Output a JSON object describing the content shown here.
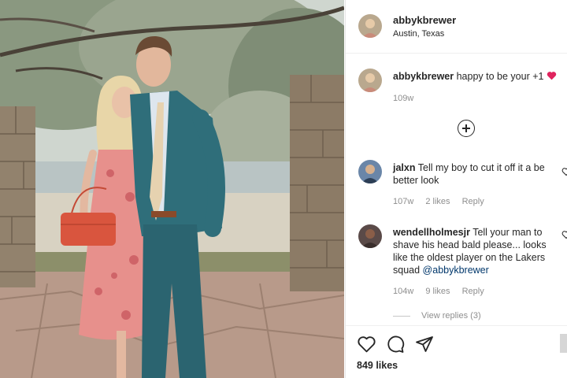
{
  "post": {
    "author": "abbykbrewer",
    "location": "Austin, Texas"
  },
  "caption": {
    "username": "abbykbrewer",
    "text": "happy to be your +1",
    "emoji": "red-heart-emoji",
    "age": "109w"
  },
  "comments": [
    {
      "username": "jalxn",
      "text": "Tell my boy to cut it off it a be better look",
      "age": "107w",
      "likes": "2 likes",
      "reply": "Reply"
    },
    {
      "username": "wendellholmesjr",
      "text": "Tell your man to shave his head bald please... looks like the oldest player on the Lakers squad",
      "mention": "@abbykbrewer",
      "age": "104w",
      "likes": "9 likes",
      "reply": "Reply",
      "view_replies": "View replies (3)"
    }
  ],
  "actions": {
    "like_icon": "heart-outline-icon",
    "comment_icon": "speech-bubble-icon",
    "share_icon": "paper-plane-icon",
    "likes_count": "849 likes"
  },
  "colors": {
    "accent_red": "#ed4956",
    "mention_blue": "#00376b",
    "muted_text": "#8e8e8e"
  }
}
